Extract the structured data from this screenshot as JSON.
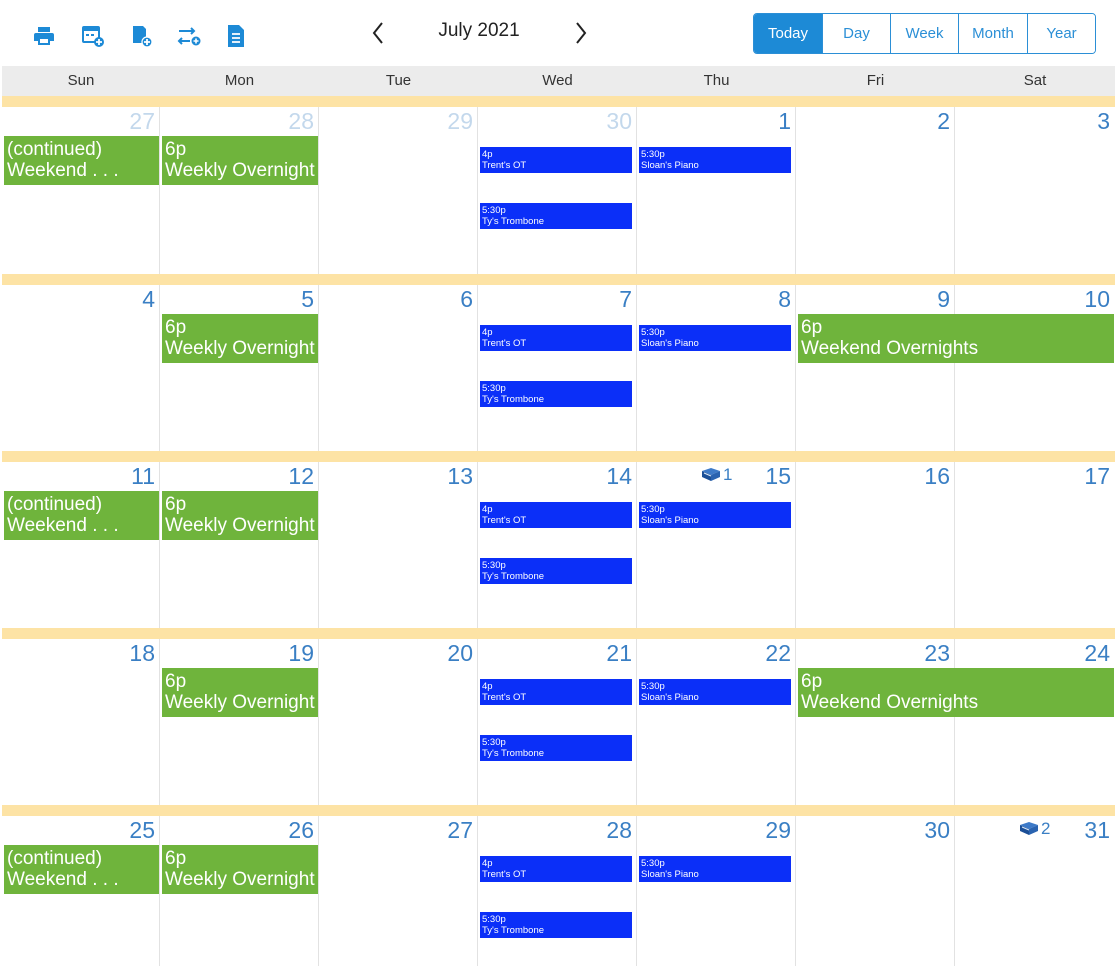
{
  "toolbar": {
    "icons": [
      {
        "name": "print-icon",
        "label": "Print"
      },
      {
        "name": "add-calendar-icon",
        "label": "Add calendar"
      },
      {
        "name": "add-event-icon",
        "label": "Add event"
      },
      {
        "name": "swap-add-icon",
        "label": "Swap"
      },
      {
        "name": "document-icon",
        "label": "Document"
      }
    ],
    "month_title": "July 2021",
    "prev_arrow": "‹",
    "next_arrow": "›",
    "views": [
      {
        "label": "Today",
        "active": true
      },
      {
        "label": "Day",
        "active": false
      },
      {
        "label": "Week",
        "active": false
      },
      {
        "label": "Month",
        "active": false
      },
      {
        "label": "Year",
        "active": false
      }
    ]
  },
  "colors": {
    "accent": "#1d8ad6",
    "day_number": "#3a7fc4",
    "muted_day": "#c3d8ec",
    "event_green": "#6fb43c",
    "event_blue": "#0b2ff8",
    "week_band": "#fde3a5",
    "header_bg": "#ececec"
  },
  "weekdays": [
    "Sun",
    "Mon",
    "Tue",
    "Wed",
    "Thu",
    "Fri",
    "Sat"
  ],
  "weeks": [
    {
      "days": [
        {
          "num": "27",
          "muted": true
        },
        {
          "num": "28",
          "muted": true
        },
        {
          "num": "29",
          "muted": true
        },
        {
          "num": "30",
          "muted": true
        },
        {
          "num": "1",
          "muted": false
        },
        {
          "num": "2",
          "muted": false
        },
        {
          "num": "3",
          "muted": false
        }
      ],
      "green_events": [
        {
          "col": 0,
          "span": 1,
          "line1": "(continued)",
          "line2": "Weekend . . ."
        },
        {
          "col": 1,
          "span": 1,
          "line1": "6p",
          "line2": "Weekly Overnight"
        }
      ],
      "blue_events": [
        {
          "col": 3,
          "slot": 0,
          "time": "4p",
          "title": "Trent's OT"
        },
        {
          "col": 3,
          "slot": 1,
          "time": "5:30p",
          "title": "Ty's Trombone"
        },
        {
          "col": 4,
          "slot": 0,
          "time": "5:30p",
          "title": "Sloan's Piano"
        }
      ],
      "notes": []
    },
    {
      "days": [
        {
          "num": "4",
          "muted": false
        },
        {
          "num": "5",
          "muted": false
        },
        {
          "num": "6",
          "muted": false
        },
        {
          "num": "7",
          "muted": false
        },
        {
          "num": "8",
          "muted": false
        },
        {
          "num": "9",
          "muted": false
        },
        {
          "num": "10",
          "muted": false
        }
      ],
      "green_events": [
        {
          "col": 1,
          "span": 1,
          "line1": "6p",
          "line2": "Weekly Overnight"
        },
        {
          "col": 5,
          "span": 2,
          "line1": "6p",
          "line2": "Weekend Overnights"
        }
      ],
      "blue_events": [
        {
          "col": 3,
          "slot": 0,
          "time": "4p",
          "title": "Trent's OT"
        },
        {
          "col": 3,
          "slot": 1,
          "time": "5:30p",
          "title": "Ty's Trombone"
        },
        {
          "col": 4,
          "slot": 0,
          "time": "5:30p",
          "title": "Sloan's Piano"
        }
      ],
      "notes": []
    },
    {
      "days": [
        {
          "num": "11",
          "muted": false
        },
        {
          "num": "12",
          "muted": false
        },
        {
          "num": "13",
          "muted": false
        },
        {
          "num": "14",
          "muted": false
        },
        {
          "num": "15",
          "muted": false
        },
        {
          "num": "16",
          "muted": false
        },
        {
          "num": "17",
          "muted": false
        }
      ],
      "green_events": [
        {
          "col": 0,
          "span": 1,
          "line1": "(continued)",
          "line2": "Weekend . . ."
        },
        {
          "col": 1,
          "span": 1,
          "line1": "6p",
          "line2": "Weekly Overnight"
        }
      ],
      "blue_events": [
        {
          "col": 3,
          "slot": 0,
          "time": "4p",
          "title": "Trent's OT"
        },
        {
          "col": 3,
          "slot": 1,
          "time": "5:30p",
          "title": "Ty's Trombone"
        },
        {
          "col": 4,
          "slot": 0,
          "time": "5:30p",
          "title": "Sloan's Piano"
        }
      ],
      "notes": [
        {
          "col": 4,
          "count": "1",
          "icon": "book-icon"
        }
      ]
    },
    {
      "days": [
        {
          "num": "18",
          "muted": false
        },
        {
          "num": "19",
          "muted": false
        },
        {
          "num": "20",
          "muted": false
        },
        {
          "num": "21",
          "muted": false
        },
        {
          "num": "22",
          "muted": false
        },
        {
          "num": "23",
          "muted": false
        },
        {
          "num": "24",
          "muted": false
        }
      ],
      "green_events": [
        {
          "col": 1,
          "span": 1,
          "line1": "6p",
          "line2": "Weekly Overnight"
        },
        {
          "col": 5,
          "span": 2,
          "line1": "6p",
          "line2": "Weekend Overnights"
        }
      ],
      "blue_events": [
        {
          "col": 3,
          "slot": 0,
          "time": "4p",
          "title": "Trent's OT"
        },
        {
          "col": 3,
          "slot": 1,
          "time": "5:30p",
          "title": "Ty's Trombone"
        },
        {
          "col": 4,
          "slot": 0,
          "time": "5:30p",
          "title": "Sloan's Piano"
        }
      ],
      "notes": []
    },
    {
      "days": [
        {
          "num": "25",
          "muted": false
        },
        {
          "num": "26",
          "muted": false
        },
        {
          "num": "27",
          "muted": false
        },
        {
          "num": "28",
          "muted": false
        },
        {
          "num": "29",
          "muted": false
        },
        {
          "num": "30",
          "muted": false
        },
        {
          "num": "31",
          "muted": false
        }
      ],
      "green_events": [
        {
          "col": 0,
          "span": 1,
          "line1": "(continued)",
          "line2": "Weekend . . ."
        },
        {
          "col": 1,
          "span": 1,
          "line1": "6p",
          "line2": "Weekly Overnight"
        }
      ],
      "blue_events": [
        {
          "col": 3,
          "slot": 0,
          "time": "4p",
          "title": "Trent's OT"
        },
        {
          "col": 3,
          "slot": 1,
          "time": "5:30p",
          "title": "Ty's Trombone"
        },
        {
          "col": 4,
          "slot": 0,
          "time": "5:30p",
          "title": "Sloan's Piano"
        }
      ],
      "notes": [
        {
          "col": 6,
          "count": "2",
          "icon": "book-icon"
        }
      ]
    }
  ]
}
